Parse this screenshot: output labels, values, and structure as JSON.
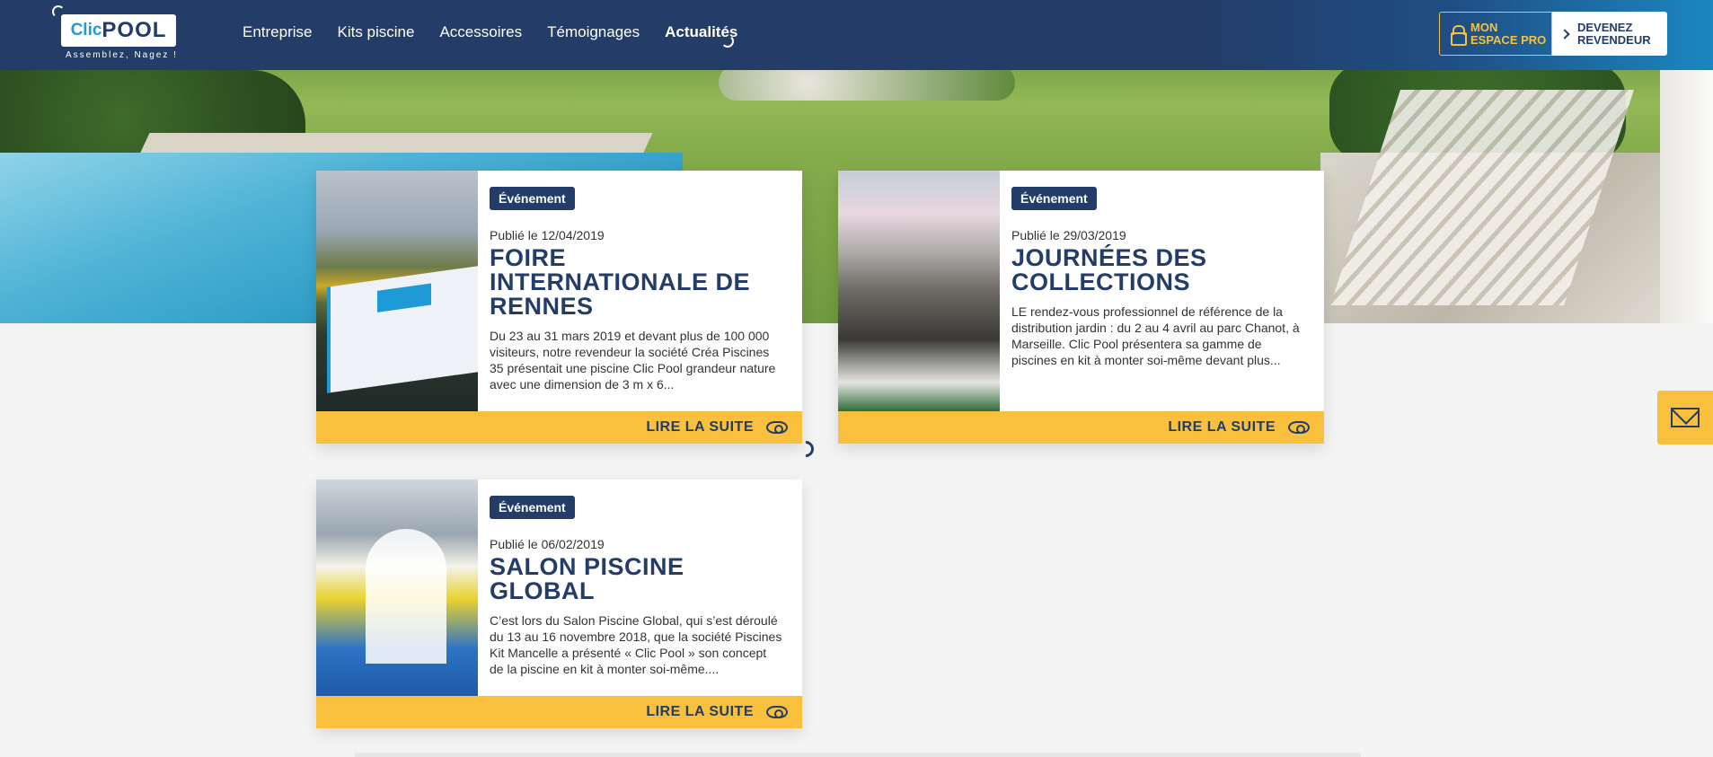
{
  "brand": {
    "logo_clic": "Clic",
    "logo_pool": "POOL",
    "tagline": "Assemblez, Nagez !"
  },
  "nav": {
    "items": [
      "Entreprise",
      "Kits piscine",
      "Accessoires",
      "Témoignages",
      "Actualités"
    ],
    "active": "Actualités"
  },
  "header_buttons": {
    "pro_line1": "MON",
    "pro_line2": "ESPACE PRO",
    "rev_line1": "DEVENEZ",
    "rev_line2": "REVENDEUR"
  },
  "colors": {
    "navy": "#233c68",
    "accent_yellow": "#f8c03c",
    "brand_blue": "#1e9bd7"
  },
  "articles": [
    {
      "badge": "Événement",
      "date": "Publié le 12/04/2019",
      "title": "FOIRE INTERNATIONALE DE RENNES",
      "excerpt": "Du 23 au 31 mars 2019 et devant plus de 100 000 visiteurs, notre revendeur la société Créa Piscines 35 présentait une piscine Clic Pool grandeur nature avec une dimension de 3 m x 6...",
      "cta": "LIRE LA SUITE"
    },
    {
      "badge": "Événement",
      "date": "Publié le 29/03/2019",
      "title": "JOURNÉES DES COLLECTIONS",
      "excerpt": "LE rendez-vous professionnel de référence de la distribution jardin : du 2 au 4 avril au parc Chanot, à Marseille.   Clic Pool présentera sa gamme de piscines en kit à monter soi-même devant plus...",
      "cta": "LIRE LA SUITE"
    },
    {
      "badge": "Événement",
      "date": "Publié le 06/02/2019",
      "title": "SALON PISCINE GLOBAL",
      "excerpt": "C’est lors du Salon Piscine Global, qui s’est déroulé du 13 au 16 novembre 2018, que la société Piscines Kit Mancelle a présenté « Clic Pool » son concept de la piscine en kit à monter soi-même....",
      "cta": "LIRE LA SUITE"
    }
  ],
  "icons": {
    "pro": "lock-icon",
    "revendeur": "chevron-right-icon",
    "read_more": "eye-icon",
    "contact": "mail-icon"
  }
}
